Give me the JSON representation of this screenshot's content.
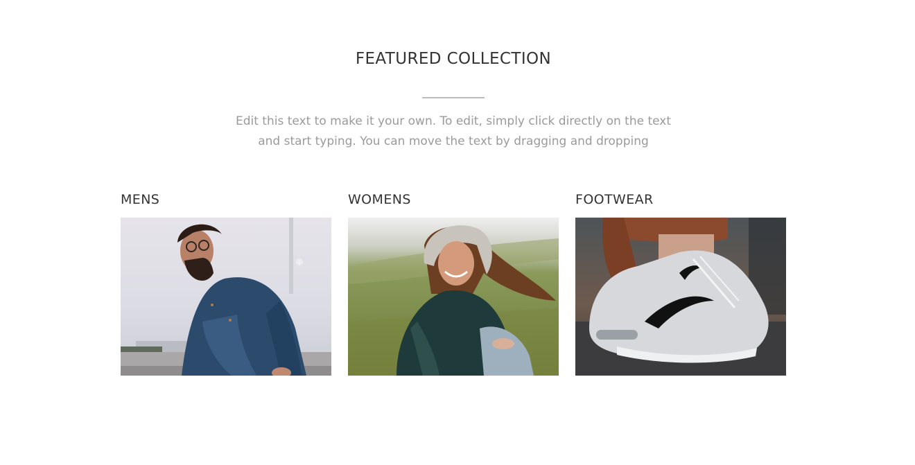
{
  "featured": {
    "title": "FEATURED COLLECTION",
    "description": "Edit this text to make it your own. To edit, simply click directly on the text and start typing. You can move the text by dragging and dropping"
  },
  "collections": [
    {
      "title": "MENS"
    },
    {
      "title": "WOMENS"
    },
    {
      "title": "FOOTWEAR"
    }
  ]
}
